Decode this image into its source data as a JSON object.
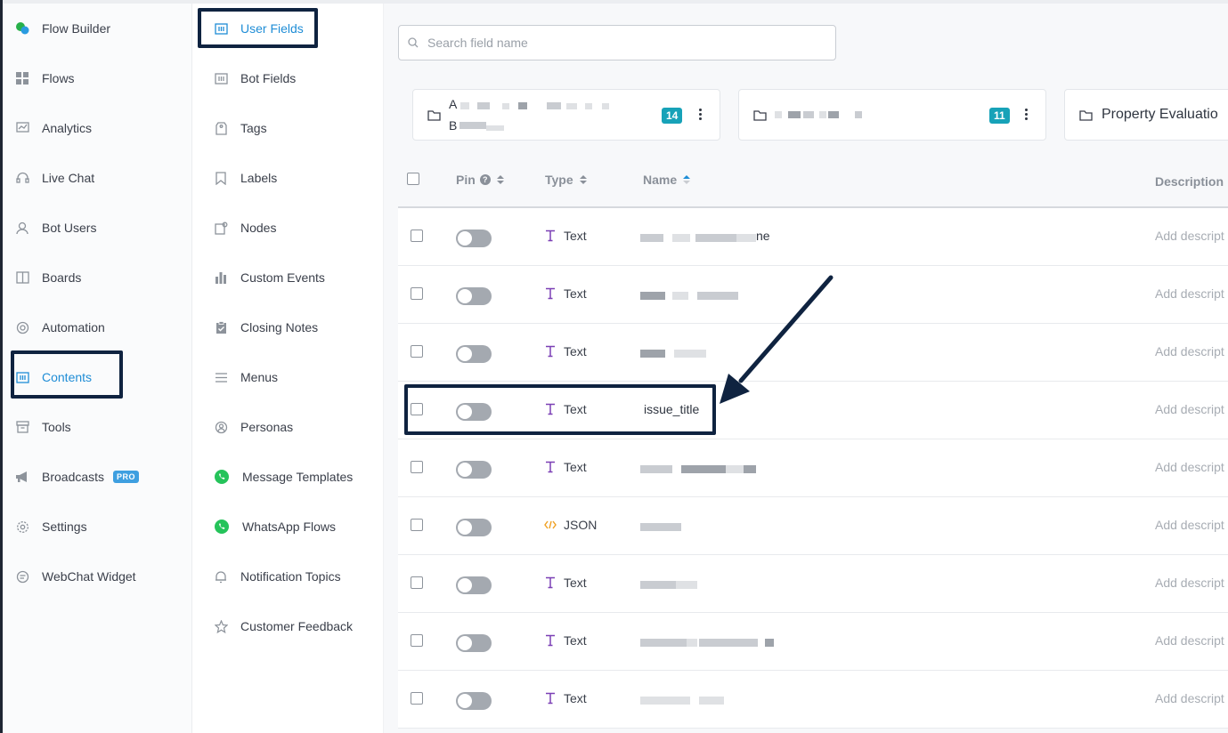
{
  "sidebar": {
    "items": [
      {
        "label": "Flow Builder",
        "icon": "chat-bubbles-icon"
      },
      {
        "label": "Flows",
        "icon": "grid-icon"
      },
      {
        "label": "Analytics",
        "icon": "chart-icon"
      },
      {
        "label": "Live Chat",
        "icon": "headset-icon"
      },
      {
        "label": "Bot Users",
        "icon": "user-icon"
      },
      {
        "label": "Boards",
        "icon": "board-icon"
      },
      {
        "label": "Automation",
        "icon": "automation-icon"
      },
      {
        "label": "Contents",
        "icon": "contents-icon",
        "active": true
      },
      {
        "label": "Tools",
        "icon": "archive-icon"
      },
      {
        "label": "Broadcasts",
        "icon": "megaphone-icon",
        "badge": "PRO"
      },
      {
        "label": "Settings",
        "icon": "gear-icon"
      },
      {
        "label": "WebChat Widget",
        "icon": "chat-icon"
      }
    ]
  },
  "subnav": {
    "items": [
      {
        "label": "User Fields",
        "icon": "fields-icon",
        "active": true
      },
      {
        "label": "Bot Fields",
        "icon": "fields-icon"
      },
      {
        "label": "Tags",
        "icon": "tag-icon"
      },
      {
        "label": "Labels",
        "icon": "bookmark-icon"
      },
      {
        "label": "Nodes",
        "icon": "node-icon"
      },
      {
        "label": "Custom Events",
        "icon": "bar-chart-icon"
      },
      {
        "label": "Closing Notes",
        "icon": "clipboard-icon"
      },
      {
        "label": "Menus",
        "icon": "menu-icon"
      },
      {
        "label": "Personas",
        "icon": "persona-icon"
      },
      {
        "label": "Message Templates",
        "icon": "whatsapp-icon"
      },
      {
        "label": "WhatsApp Flows",
        "icon": "whatsapp-icon"
      },
      {
        "label": "Notification Topics",
        "icon": "bell-icon"
      },
      {
        "label": "Customer Feedback",
        "icon": "star-icon"
      }
    ]
  },
  "search": {
    "placeholder": "Search field name"
  },
  "folders": [
    {
      "prefix_a": "A",
      "prefix_b": "B",
      "count": "14"
    },
    {
      "count": "11"
    },
    {
      "name": "Property Evaluatio"
    }
  ],
  "table": {
    "headers": {
      "pin": "Pin",
      "type": "Type",
      "name": "Name",
      "description": "Description"
    },
    "rows": [
      {
        "type": "Text",
        "type_icon": "text-type-icon",
        "name_suffix": "ne",
        "description": "Add descript"
      },
      {
        "type": "Text",
        "type_icon": "text-type-icon",
        "description": "Add descript"
      },
      {
        "type": "Text",
        "type_icon": "text-type-icon",
        "description": "Add descript"
      },
      {
        "type": "Text",
        "type_icon": "text-type-icon",
        "name": "issue_title",
        "description": "Add descript",
        "highlighted": true
      },
      {
        "type": "Text",
        "type_icon": "text-type-icon",
        "description": "Add descript"
      },
      {
        "type": "JSON",
        "type_icon": "code-icon",
        "description": "Add descript"
      },
      {
        "type": "Text",
        "type_icon": "text-type-icon",
        "description": "Add descript"
      },
      {
        "type": "Text",
        "type_icon": "text-type-icon",
        "description": "Add descript"
      },
      {
        "type": "Text",
        "type_icon": "text-type-icon",
        "description": "Add descript"
      }
    ]
  },
  "colors": {
    "accent": "#1f8dd6",
    "highlight_box": "#0f2340",
    "badge": "#17a2b8",
    "text_type": "#7b3fb5",
    "json_type": "#f0a020"
  }
}
